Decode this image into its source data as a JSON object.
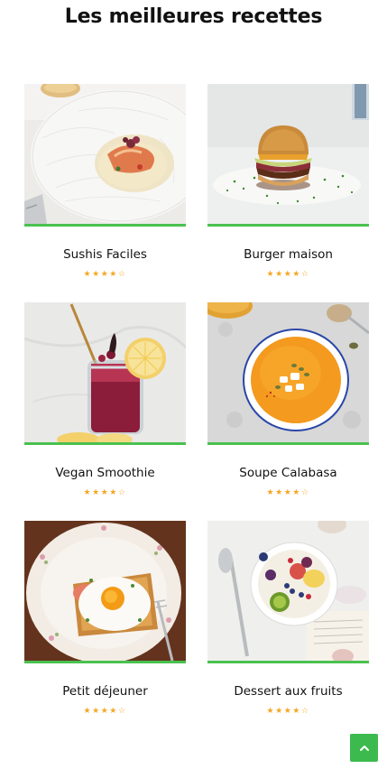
{
  "page": {
    "title": "Les meilleures recettes"
  },
  "recipes": [
    {
      "title": "Sushis Faciles",
      "rating": 4,
      "max_rating": 5,
      "image": "plated-seafood-image"
    },
    {
      "title": "Burger maison",
      "rating": 4,
      "max_rating": 5,
      "image": "burger-image"
    },
    {
      "title": "Vegan Smoothie",
      "rating": 4,
      "max_rating": 5,
      "image": "smoothie-jar-image"
    },
    {
      "title": "Soupe Calabasa",
      "rating": 4,
      "max_rating": 5,
      "image": "pumpkin-soup-image"
    },
    {
      "title": "Petit déjeuner",
      "rating": 4,
      "max_rating": 5,
      "image": "fried-egg-toast-image"
    },
    {
      "title": "Dessert aux fruits",
      "rating": 4,
      "max_rating": 5,
      "image": "fruit-bowl-image"
    }
  ],
  "colors": {
    "accent": "#4ac14f",
    "star": "#f5a623",
    "scroll_button": "#3dba4d"
  },
  "scroll_top": {
    "icon": "chevron-up-icon"
  }
}
